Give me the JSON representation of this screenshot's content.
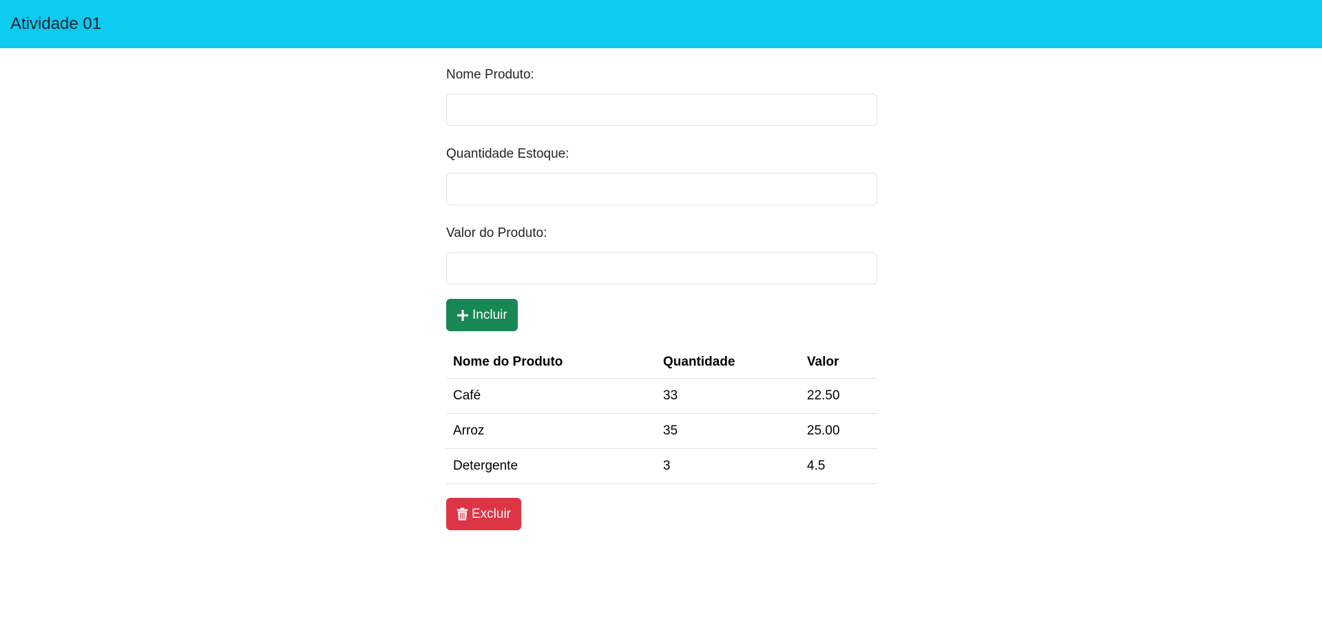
{
  "navbar": {
    "title": "Atividade 01"
  },
  "form": {
    "nome": {
      "label": "Nome Produto:",
      "value": "",
      "placeholder": ""
    },
    "quantidade": {
      "label": "Quantidade Estoque:",
      "value": "",
      "placeholder": ""
    },
    "valor": {
      "label": "Valor do Produto:",
      "value": "",
      "placeholder": ""
    },
    "add_label": "Incluir"
  },
  "table": {
    "headers": [
      "Nome do Produto",
      "Quantidade",
      "Valor"
    ],
    "rows": [
      [
        "Café",
        "33",
        "22.50"
      ],
      [
        "Arroz",
        "35",
        "25.00"
      ],
      [
        "Detergente",
        "3",
        "4.5"
      ]
    ]
  },
  "delete_label": "Excluir",
  "colors": {
    "navbar": "#0dcaf0",
    "success": "#198754",
    "danger": "#dc3545"
  },
  "icons": {
    "add": "plus-icon",
    "delete": "trash-icon"
  }
}
